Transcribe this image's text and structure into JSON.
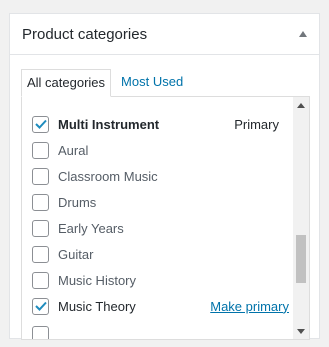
{
  "panel": {
    "title": "Product categories",
    "toggle_icon": "triangle-up-icon"
  },
  "tabs": [
    {
      "label": "All categories",
      "active": true
    },
    {
      "label": "Most Used",
      "active": false
    }
  ],
  "categories": [
    {
      "label": "Multi Instrument",
      "checked": true,
      "primary": true
    },
    {
      "label": "Aural",
      "checked": false
    },
    {
      "label": "Classroom Music",
      "checked": false
    },
    {
      "label": "Drums",
      "checked": false
    },
    {
      "label": "Early Years",
      "checked": false
    },
    {
      "label": "Guitar",
      "checked": false
    },
    {
      "label": "Music History",
      "checked": false
    },
    {
      "label": "Music Theory",
      "checked": true
    }
  ],
  "labels": {
    "primary": "Primary",
    "make_primary": "Make primary"
  },
  "colors": {
    "accent": "#0073aa",
    "text": "#23282d",
    "muted_text": "#555d66",
    "border": "#dddddd"
  }
}
